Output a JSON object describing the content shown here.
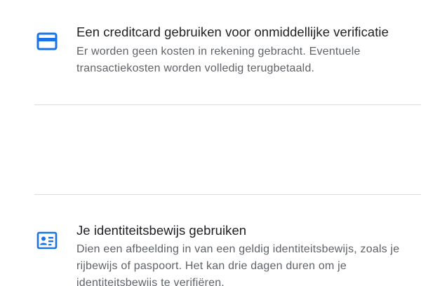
{
  "options": [
    {
      "icon": "credit-card-icon",
      "title": "Een creditcard gebruiken voor onmiddellijke verificatie",
      "description": "Er worden geen kosten in rekening gebracht. Eventuele transactiekosten worden volledig terugbetaald."
    },
    {
      "icon": "id-card-icon",
      "title": "Je identiteitsbewijs gebruiken",
      "description": "Dien een afbeelding in van een geldig identiteitsbewijs, zoals je rijbewijs of paspoort. Het kan drie dagen duren om je identiteitsbewijs te verifiëren."
    }
  ],
  "colors": {
    "icon": "#1a73e8",
    "title": "#202124",
    "description": "#5f6368",
    "divider": "#dadce0"
  }
}
